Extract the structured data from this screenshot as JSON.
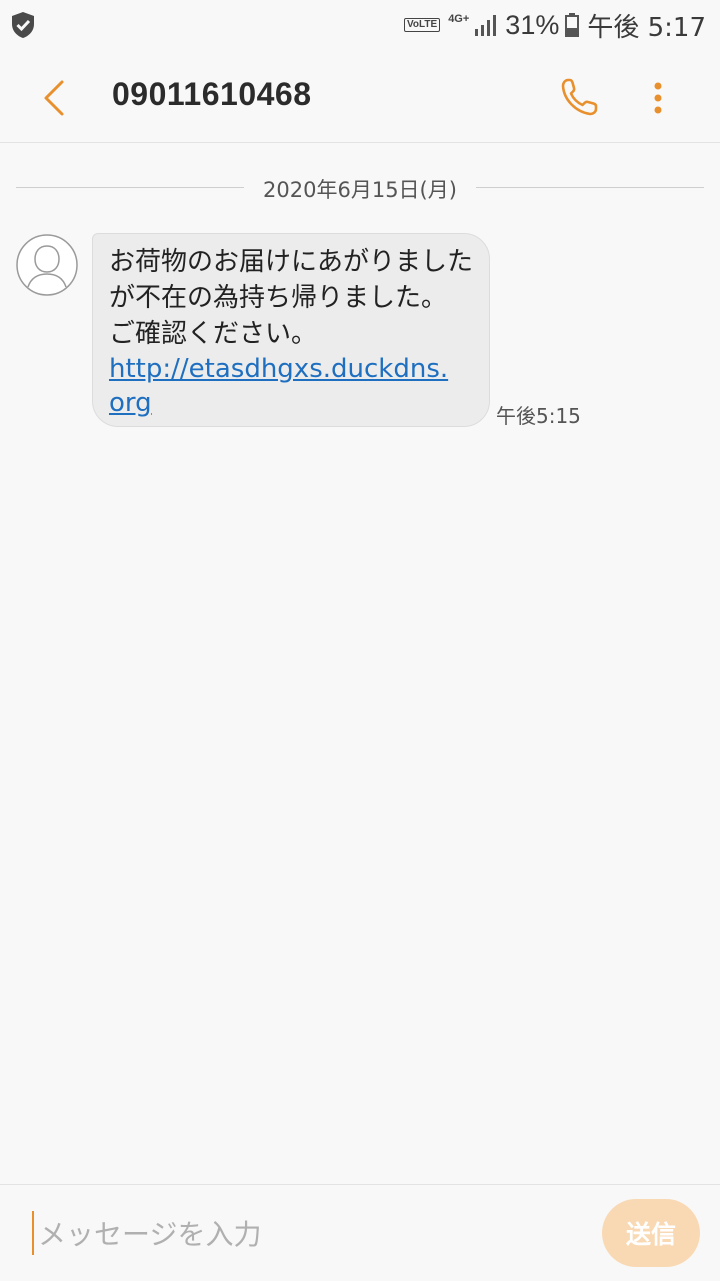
{
  "status_bar": {
    "volte": "VoLTE",
    "network": "4G+",
    "battery_percent": "31%",
    "time": "午後 5:17",
    "icons": [
      "shield-check-icon",
      "signal-icon",
      "battery-icon"
    ]
  },
  "header": {
    "title": "09011610468",
    "icons": [
      "back-arrow-icon",
      "phone-icon",
      "more-vert-icon"
    ]
  },
  "conversation": {
    "date": "2020年6月15日(月)",
    "messages": [
      {
        "text": "お荷物のお届けにあがりましたが不在の為持ち帰りました。 ご確認ください。",
        "link": "http://etasdhgxs.duckdns.org",
        "time": "午後5:15",
        "avatar_icon": "person-avatar-icon"
      }
    ]
  },
  "composer": {
    "placeholder": "メッセージを入力",
    "value": "",
    "send_label": "送信"
  },
  "colors": {
    "accent": "#e8902e",
    "send_button_disabled": "#f9d9b3",
    "bubble": "#ececec",
    "link": "#1e6fc0"
  }
}
